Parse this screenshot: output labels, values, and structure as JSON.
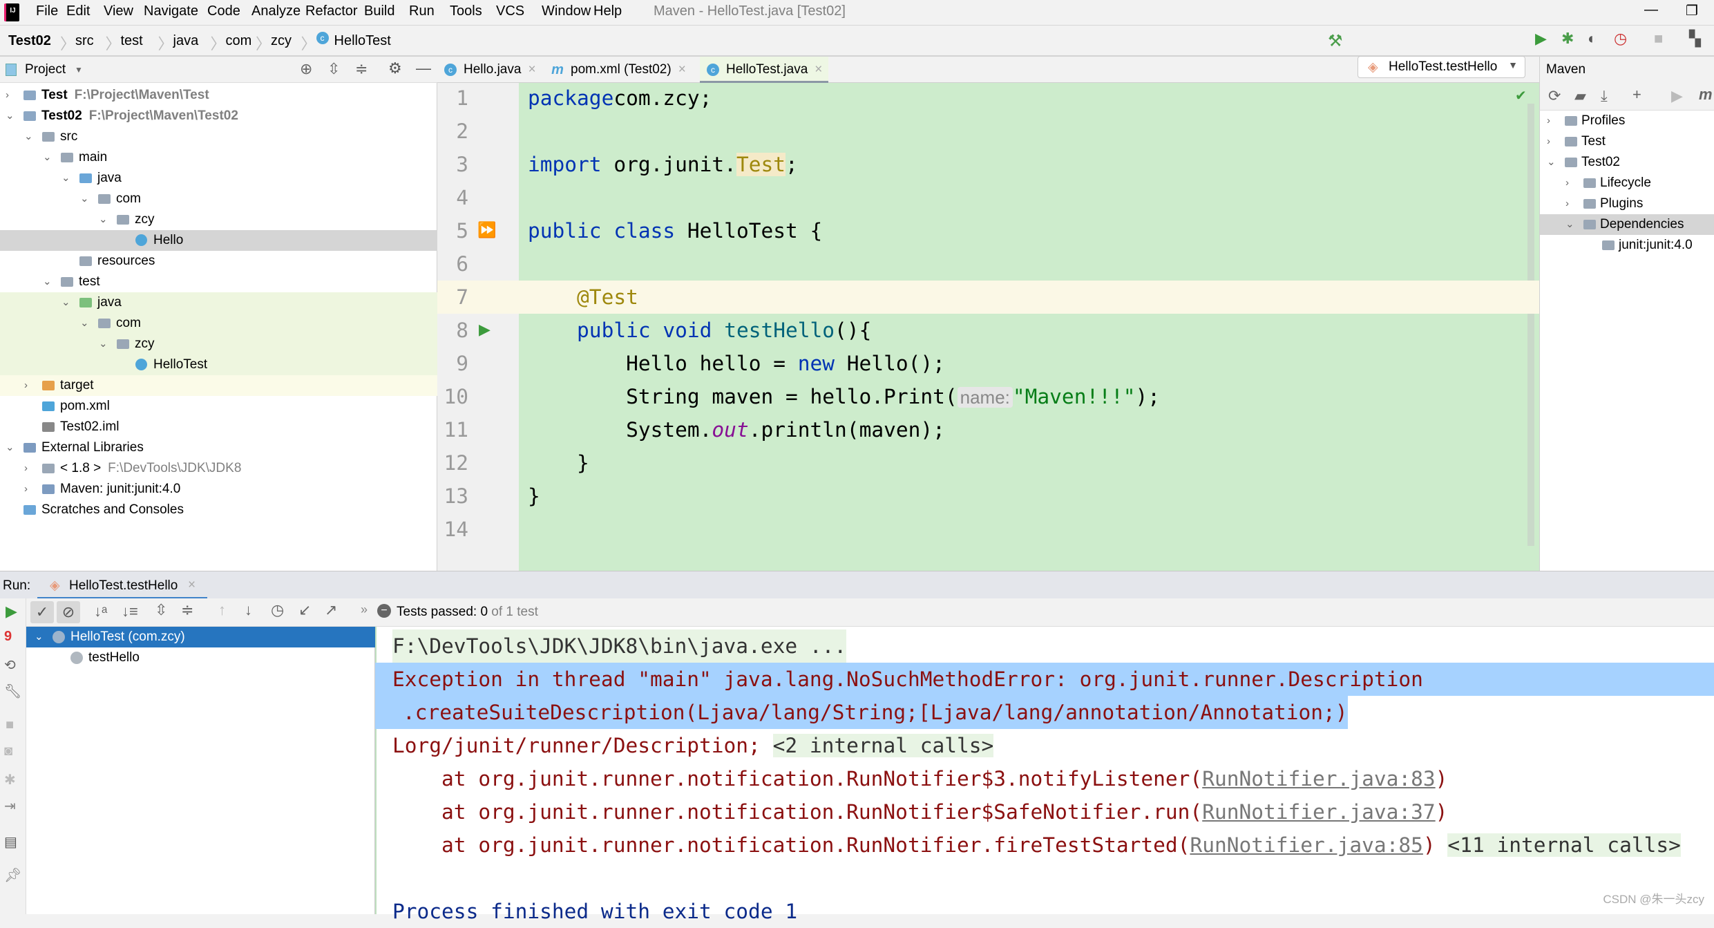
{
  "menu": [
    "File",
    "Edit",
    "View",
    "Navigate",
    "Code",
    "Analyze",
    "Refactor",
    "Build",
    "Run",
    "Tools",
    "VCS",
    "Window",
    "Help"
  ],
  "window_title": "Maven - HelloTest.java [Test02]",
  "breadcrumb": [
    "Test02",
    "src",
    "test",
    "java",
    "com",
    "zcy",
    "HelloTest"
  ],
  "run_config": "HelloTest.testHello",
  "project_panel": {
    "title": "Project",
    "tree": [
      {
        "label": "Test",
        "sub": "F:\\Project\\Maven\\Test",
        "depth": 0,
        "arrow": "right",
        "icon": "module",
        "bold": true
      },
      {
        "label": "Test02",
        "sub": "F:\\Project\\Maven\\Test02",
        "depth": 0,
        "arrow": "down",
        "icon": "module",
        "bold": true
      },
      {
        "label": "src",
        "depth": 1,
        "arrow": "down",
        "icon": "folder"
      },
      {
        "label": "main",
        "depth": 2,
        "arrow": "down",
        "icon": "folder"
      },
      {
        "label": "java",
        "depth": 3,
        "arrow": "down",
        "icon": "source-folder"
      },
      {
        "label": "com",
        "depth": 4,
        "arrow": "down",
        "icon": "package"
      },
      {
        "label": "zcy",
        "depth": 5,
        "arrow": "down",
        "icon": "package"
      },
      {
        "label": "Hello",
        "depth": 6,
        "icon": "class",
        "selected": true
      },
      {
        "label": "resources",
        "depth": 3,
        "icon": "resources-folder"
      },
      {
        "label": "test",
        "depth": 2,
        "arrow": "down",
        "icon": "folder"
      },
      {
        "label": "java",
        "depth": 3,
        "arrow": "down",
        "icon": "test-folder",
        "tint": "green"
      },
      {
        "label": "com",
        "depth": 4,
        "arrow": "down",
        "icon": "package",
        "tint": "green"
      },
      {
        "label": "zcy",
        "depth": 5,
        "arrow": "down",
        "icon": "package",
        "tint": "green"
      },
      {
        "label": "HelloTest",
        "depth": 6,
        "icon": "test-class",
        "tint": "green"
      },
      {
        "label": "target",
        "depth": 1,
        "arrow": "right",
        "icon": "excluded-folder",
        "tint": "yellow"
      },
      {
        "label": "pom.xml",
        "depth": 1,
        "icon": "maven"
      },
      {
        "label": "Test02.iml",
        "depth": 1,
        "icon": "iml"
      },
      {
        "label": "External Libraries",
        "depth": 0,
        "arrow": "down",
        "icon": "library"
      },
      {
        "label": "< 1.8 >",
        "sub": "F:\\DevTools\\JDK\\JDK8",
        "depth": 1,
        "arrow": "right",
        "icon": "jdk"
      },
      {
        "label": "Maven: junit:junit:4.0",
        "depth": 1,
        "arrow": "right",
        "icon": "library"
      },
      {
        "label": "Scratches and Consoles",
        "depth": 0,
        "icon": "scratches"
      }
    ]
  },
  "editor_tabs": [
    {
      "label": "Hello.java",
      "icon": "class"
    },
    {
      "label": "pom.xml (Test02)",
      "icon": "maven"
    },
    {
      "label": "HelloTest.java",
      "icon": "test-class",
      "active": true
    }
  ],
  "code": [
    [
      [
        "kw",
        "package"
      ],
      [
        "",
        "com.zcy;"
      ]
    ],
    [],
    [
      [
        "kw",
        "import"
      ],
      [
        "",
        " org.junit."
      ],
      [
        "an hl",
        "Test"
      ],
      [
        "",
        ";"
      ]
    ],
    [],
    [
      [
        "kw",
        "public class"
      ],
      [
        "",
        " HelloTest {"
      ]
    ],
    [],
    [
      [
        "",
        "    "
      ],
      [
        "an",
        "@Test"
      ]
    ],
    [
      [
        "",
        "    "
      ],
      [
        "kw",
        "public void"
      ],
      [
        "",
        " "
      ],
      [
        "fn",
        "testHello"
      ],
      [
        "",
        "(){"
      ]
    ],
    [
      [
        "",
        "        Hello hello = "
      ],
      [
        "kw",
        "new"
      ],
      [
        "",
        " Hello();"
      ]
    ],
    [
      [
        "",
        "        String maven = hello.Print("
      ],
      [
        "hint",
        "name:"
      ],
      [
        "st",
        "\"Maven!!!\""
      ],
      [
        "",
        ");"
      ]
    ],
    [
      [
        "",
        "        System."
      ],
      [
        "it",
        "out"
      ],
      [
        "",
        ".println(maven);"
      ]
    ],
    [
      [
        "",
        "    }"
      ]
    ],
    [
      [
        "",
        "}"
      ]
    ],
    []
  ],
  "maven_panel": {
    "title": "Maven",
    "tree": [
      {
        "label": "Profiles",
        "depth": 0,
        "arrow": "right"
      },
      {
        "label": "Test",
        "depth": 0,
        "arrow": "right"
      },
      {
        "label": "Test02",
        "depth": 0,
        "arrow": "down"
      },
      {
        "label": "Lifecycle",
        "depth": 1,
        "arrow": "right"
      },
      {
        "label": "Plugins",
        "depth": 1,
        "arrow": "right"
      },
      {
        "label": "Dependencies",
        "depth": 1,
        "arrow": "down",
        "selected": true
      },
      {
        "label": "junit:junit:4.0",
        "depth": 2
      }
    ]
  },
  "run_panel": {
    "label": "Run:",
    "tab": "HelloTest.testHello",
    "status_prefix": "Tests passed: ",
    "passed": "0",
    "status_suffix": " of 1 test",
    "tests": [
      {
        "label": "HelloTest (com.zcy)",
        "selected": true
      },
      {
        "label": "testHello"
      }
    ],
    "console": [
      {
        "text": "F:\\DevTools\\JDK\\JDK8\\bin\\java.exe ...",
        "style": "cmd"
      },
      {
        "text": "Exception in thread \"main\" java.lang.NoSuchMethodError: org.junit.runner.Description",
        "style": "sel"
      },
      {
        "text": ".createSuiteDescription(Ljava/lang/String;[Ljava/lang/annotation/Annotation;)",
        "style": "sel"
      },
      {
        "text": "Lorg/junit/runner/Description;",
        "internal": "<2 internal calls>"
      },
      {
        "text": "    at org.junit.runner.notification.RunNotifier$3.notifyListener(",
        "link": "RunNotifier.java:83",
        "end": ")"
      },
      {
        "text": "    at org.junit.runner.notification.RunNotifier$SafeNotifier.run(",
        "link": "RunNotifier.java:37",
        "end": ")"
      },
      {
        "text": "    at org.junit.runner.notification.RunNotifier.fireTestStarted(",
        "link": "RunNotifier.java:85",
        "end": ")",
        "internal": "<11 internal calls>"
      },
      {
        "text": ""
      },
      {
        "text": "Process finished with exit code 1",
        "style": "exit"
      }
    ]
  },
  "watermark": "CSDN @朱一头zcy",
  "colors": {
    "code_bg": "#cdeccc",
    "error": "#8b1010",
    "selection": "#a6d2ff",
    "accent": "#2675bf"
  }
}
